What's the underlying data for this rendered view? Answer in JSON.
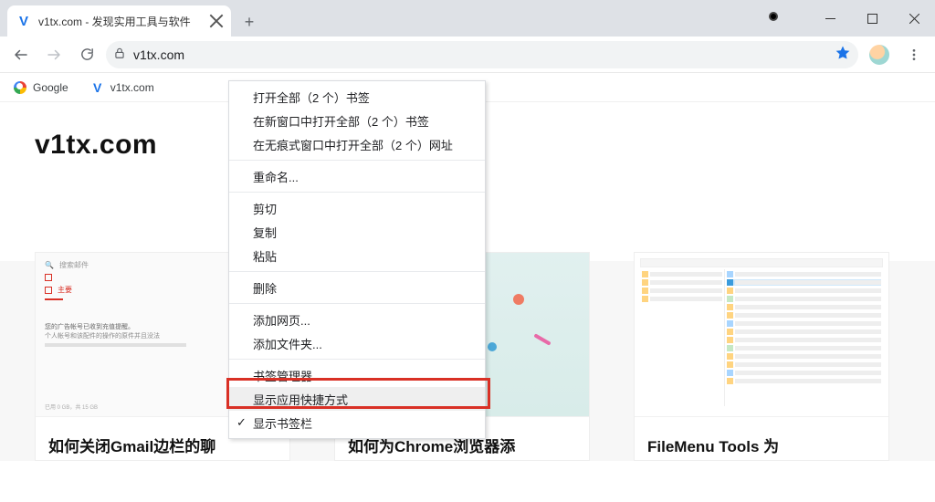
{
  "tab": {
    "title": "v1tx.com - 发现实用工具与软件",
    "favicon_letter": "V"
  },
  "address": {
    "url": "v1tx.com"
  },
  "bookmarks": [
    {
      "label": "Google",
      "favicon": "google"
    },
    {
      "label": "v1tx.com",
      "favicon": "v1tx",
      "favicon_letter": "V"
    }
  ],
  "site": {
    "logo": "v1tx.com"
  },
  "cards": [
    {
      "title": "如何关闭Gmail边栏的聊"
    },
    {
      "title": "如何为Chrome浏览器添"
    },
    {
      "title": "FileMenu Tools 为"
    }
  ],
  "context_menu": {
    "items": [
      {
        "label": "打开全部（2 个）书签"
      },
      {
        "label": "在新窗口中打开全部（2 个）书签"
      },
      {
        "label": "在无痕式窗口中打开全部（2 个）网址"
      },
      {
        "sep": true
      },
      {
        "label": "重命名..."
      },
      {
        "sep": true
      },
      {
        "label": "剪切"
      },
      {
        "label": "复制"
      },
      {
        "label": "粘贴"
      },
      {
        "sep": true
      },
      {
        "label": "删除"
      },
      {
        "sep": true
      },
      {
        "label": "添加网页..."
      },
      {
        "label": "添加文件夹..."
      },
      {
        "sep": true
      },
      {
        "label": "书签管理器"
      },
      {
        "label": "显示应用快捷方式",
        "selected": true
      },
      {
        "label": "显示书签栏",
        "checked": true
      }
    ]
  },
  "gmail_thumb": {
    "search_icon": "🔍",
    "search_placeholder": "搜索邮件",
    "primary": "主要",
    "line1": "您的广告帐号已收到充值提醒。",
    "line2": "个人帐号和该配件的操作的原件并且没法",
    "footer": "已用 0 GB，共 15 GB"
  }
}
